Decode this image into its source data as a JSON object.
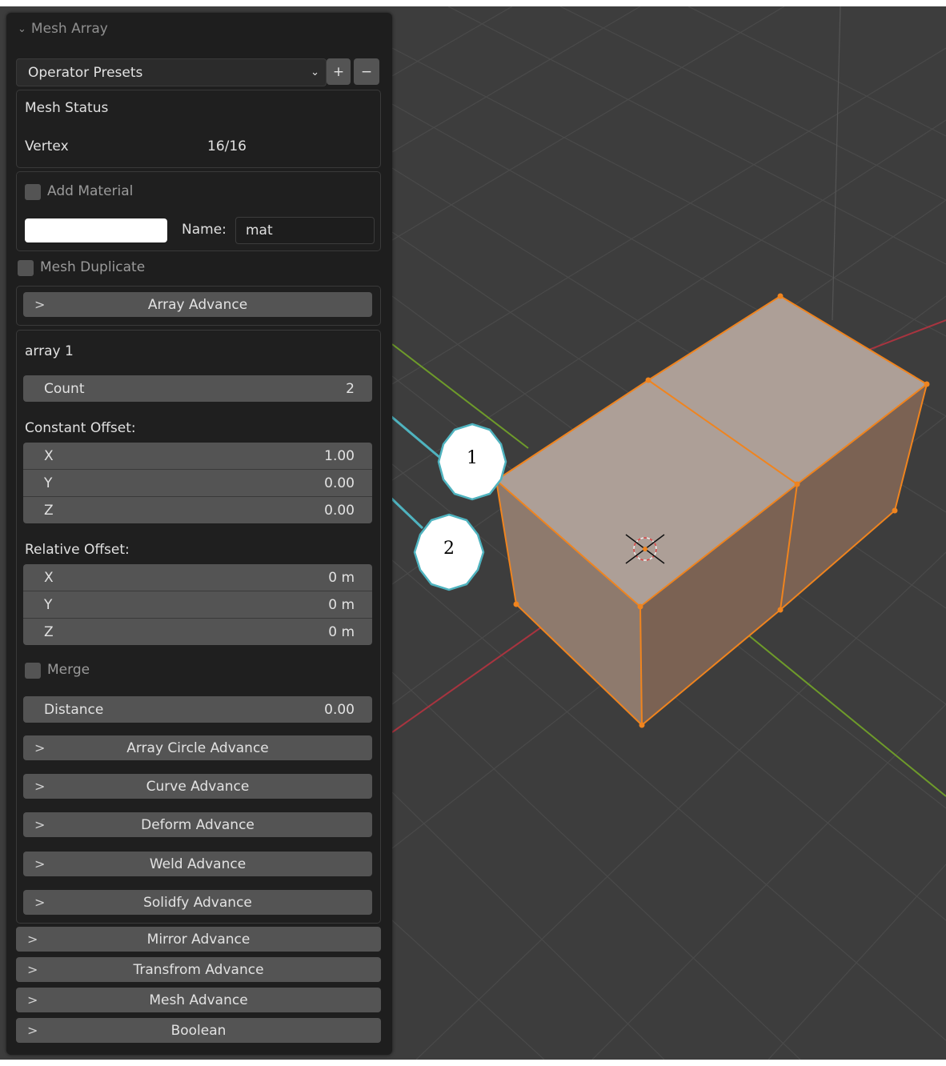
{
  "panel": {
    "title": "Mesh Array",
    "presets": {
      "label": "Operator Presets",
      "add": "+",
      "remove": "−"
    },
    "mesh_status": {
      "title": "Mesh Status",
      "vertex_label": "Vertex",
      "vertex_value": "16/16"
    },
    "material": {
      "checkbox_label": "Add Material",
      "name_label": "Name:",
      "name_value": "mat"
    },
    "mesh_duplicate": "Mesh Duplicate",
    "array_advance": "Array Advance",
    "array1": {
      "title": "array 1",
      "count_label": "Count",
      "count_value": "2",
      "constant_offset_label": "Constant Offset:",
      "constant_offset": [
        {
          "axis": "X",
          "value": "1.00"
        },
        {
          "axis": "Y",
          "value": "0.00"
        },
        {
          "axis": "Z",
          "value": "0.00"
        }
      ],
      "relative_offset_label": "Relative Offset:",
      "relative_offset": [
        {
          "axis": "X",
          "value": "0 m"
        },
        {
          "axis": "Y",
          "value": "0 m"
        },
        {
          "axis": "Z",
          "value": "0 m"
        }
      ],
      "merge_label": "Merge",
      "distance_label": "Distance",
      "distance_value": "0.00",
      "sub_advances": [
        "Array Circle Advance",
        "Curve Advance",
        "Deform Advance",
        "Weld Advance",
        "Solidfy Advance"
      ]
    },
    "bottom_advances": [
      "Mirror Advance",
      "Transfrom Advance",
      "Mesh Advance",
      "Boolean"
    ]
  },
  "callouts": [
    "1",
    "2"
  ],
  "colors": {
    "viewport_bg": "#3d3d3d",
    "panel_bg": "#1e1e1e",
    "field_bg": "#545454",
    "selection_orange": "#f0841e",
    "callout_teal": "#4fb3bf",
    "axis_red": "#a8343f",
    "axis_green": "#6e9b2a"
  }
}
